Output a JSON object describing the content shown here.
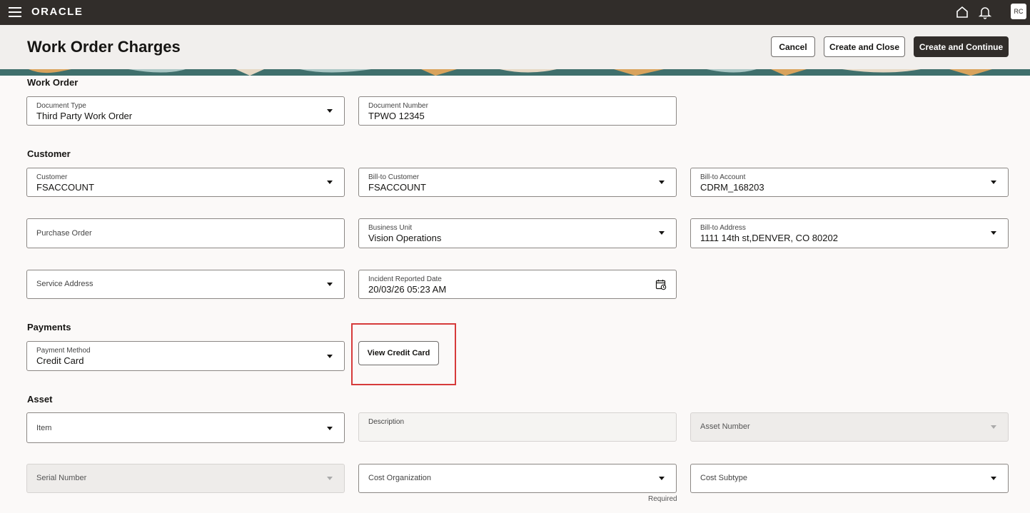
{
  "topbar": {
    "logo": "ORACLE",
    "avatar_initials": "RC",
    "icons": [
      "menu-icon",
      "home-icon",
      "bell-icon"
    ]
  },
  "header": {
    "title": "Work Order Charges",
    "cancel_label": "Cancel",
    "create_close_label": "Create and Close",
    "create_continue_label": "Create and Continue"
  },
  "work_order": {
    "section_title": "Work Order",
    "document_type": {
      "label": "Document Type",
      "value": "Third Party Work Order"
    },
    "document_number": {
      "label": "Document Number",
      "value": "TPWO 12345"
    }
  },
  "customer": {
    "section_title": "Customer",
    "customer": {
      "label": "Customer",
      "value": "FSACCOUNT"
    },
    "bill_to_customer": {
      "label": "Bill-to Customer",
      "value": "FSACCOUNT"
    },
    "bill_to_account": {
      "label": "Bill-to Account",
      "value": "CDRM_168203"
    },
    "purchase_order": {
      "label": "Purchase Order",
      "value": ""
    },
    "business_unit": {
      "label": "Business Unit",
      "value": "Vision Operations"
    },
    "bill_to_address": {
      "label": "Bill-to Address",
      "value": "1111 14th st,DENVER, CO 80202"
    },
    "service_address": {
      "label": "Service Address",
      "value": ""
    },
    "incident_reported_date": {
      "label": "Incident Reported Date",
      "value": "20/03/26 05:23 AM"
    }
  },
  "payments": {
    "section_title": "Payments",
    "payment_method": {
      "label": "Payment Method",
      "value": "Credit Card"
    },
    "view_credit_card_label": "View Credit Card"
  },
  "asset": {
    "section_title": "Asset",
    "item": {
      "label": "Item"
    },
    "description": {
      "label": "Description"
    },
    "asset_number": {
      "label": "Asset Number"
    },
    "serial_number": {
      "label": "Serial Number"
    },
    "cost_organization": {
      "label": "Cost Organization",
      "hint": "Required"
    },
    "cost_subtype": {
      "label": "Cost Subtype"
    }
  },
  "colors": {
    "topbar": "#312d2a",
    "header": "#f1efed",
    "highlight": "#d63b3b",
    "banner": "#3f6f6c"
  }
}
